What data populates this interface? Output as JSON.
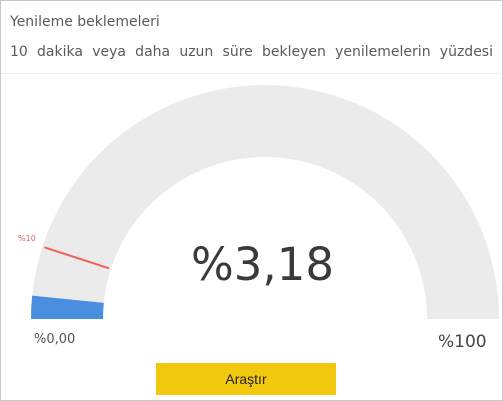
{
  "header": {
    "title": "Yenileme beklemeleri",
    "subtitle": "10 dakika veya daha uzun süre bekleyen yenilemelerin yüzdesi"
  },
  "gauge": {
    "value_label": "%3,18",
    "min_label": "%0,00",
    "max_label": "%100",
    "target_label": "%10",
    "value_fraction": 0.0318,
    "target_fraction": 0.1,
    "colors": {
      "track": "#ebebeb",
      "fill": "#4a8fdf",
      "target": "#f0605a"
    }
  },
  "actions": {
    "investigate_label": "Araştır",
    "button_color": "#f2c80f"
  }
}
